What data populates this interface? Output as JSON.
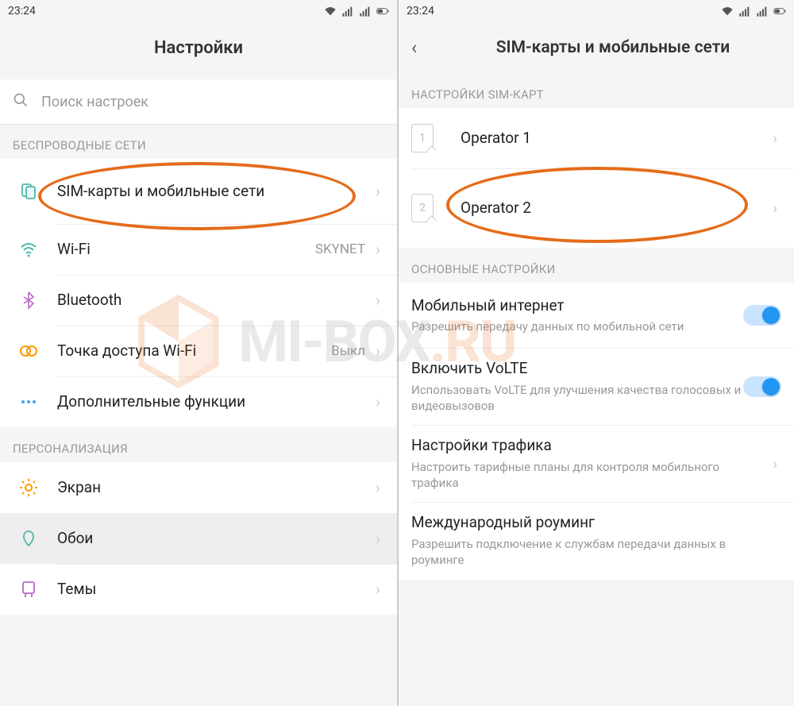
{
  "status": {
    "time": "23:24"
  },
  "left": {
    "title": "Настройки",
    "search_placeholder": "Поиск настроек",
    "section_wireless": "БЕСПРОВОДНЫЕ СЕТИ",
    "section_personalization": "ПЕРСОНАЛИЗАЦИЯ",
    "items": {
      "sim": "SIM-карты и мобильные сети",
      "wifi": "Wi-Fi",
      "wifi_value": "SKYNET",
      "bluetooth": "Bluetooth",
      "hotspot": "Точка доступа Wi-Fi",
      "hotspot_value": "Выкл",
      "more": "Дополнительные функции",
      "display": "Экран",
      "wallpaper": "Обои",
      "themes": "Темы"
    }
  },
  "right": {
    "title": "SIM-карты и мобильные сети",
    "section_sim": "НАСТРОЙКИ SIM-КАРТ",
    "section_main": "ОСНОВНЫЕ НАСТРОЙКИ",
    "sim1": "Operator 1",
    "sim1_num": "1",
    "sim2": "Operator 2",
    "sim2_num": "2",
    "mobile_data": "Мобильный интернет",
    "mobile_data_sub": "Разрешить передачу данных по мобильной сети",
    "volte": "Включить VoLTE",
    "volte_sub": "Использовать VoLTE для улучшения качества голосовых и видеовызовов",
    "traffic": "Настройки трафика",
    "traffic_sub": "Настроить тарифные планы для контроля мобильного трафика",
    "roaming": "Международный роуминг",
    "roaming_sub": "Разрешить подключение к службам передачи данных в роуминге"
  },
  "watermark": "MI-BOX"
}
